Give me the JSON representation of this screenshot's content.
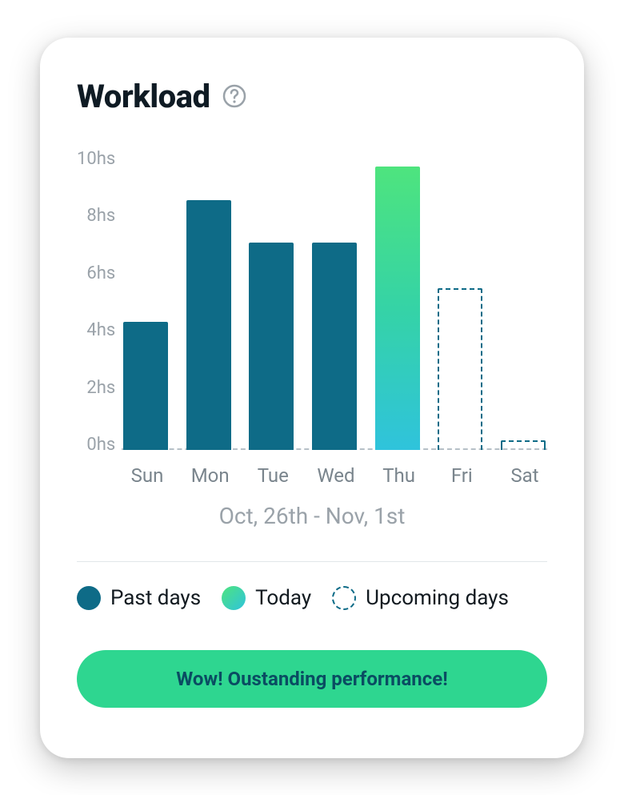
{
  "header": {
    "title": "Workload"
  },
  "chart_data": {
    "type": "bar",
    "categories": [
      "Sun",
      "Mon",
      "Tue",
      "Wed",
      "Thu",
      "Fri",
      "Sat"
    ],
    "series": [
      {
        "name": "Past days",
        "color": "#0e6b87"
      },
      {
        "name": "Today",
        "color": "gradient:#4ee47e-#2fc3dc"
      },
      {
        "name": "Upcoming days",
        "color": "dashed:#0e6b87"
      }
    ],
    "values": [
      4.2,
      8.2,
      6.8,
      6.8,
      9.3,
      5.3,
      0.3
    ],
    "types": [
      "past",
      "past",
      "past",
      "past",
      "today",
      "upcoming",
      "upcoming"
    ],
    "title": "Workload",
    "xlabel": "",
    "ylabel": "hs",
    "ylim": [
      0,
      10
    ],
    "y_ticks": [
      "10hs",
      "8hs",
      "6hs",
      "4hs",
      "2hs",
      "0hs"
    ],
    "date_range": "Oct, 26th - Nov, 1st",
    "legend_position": "bottom"
  },
  "legend": {
    "past": "Past days",
    "today": "Today",
    "upcoming": "Upcoming days"
  },
  "banner": {
    "text": "Wow! Oustanding performance!"
  }
}
